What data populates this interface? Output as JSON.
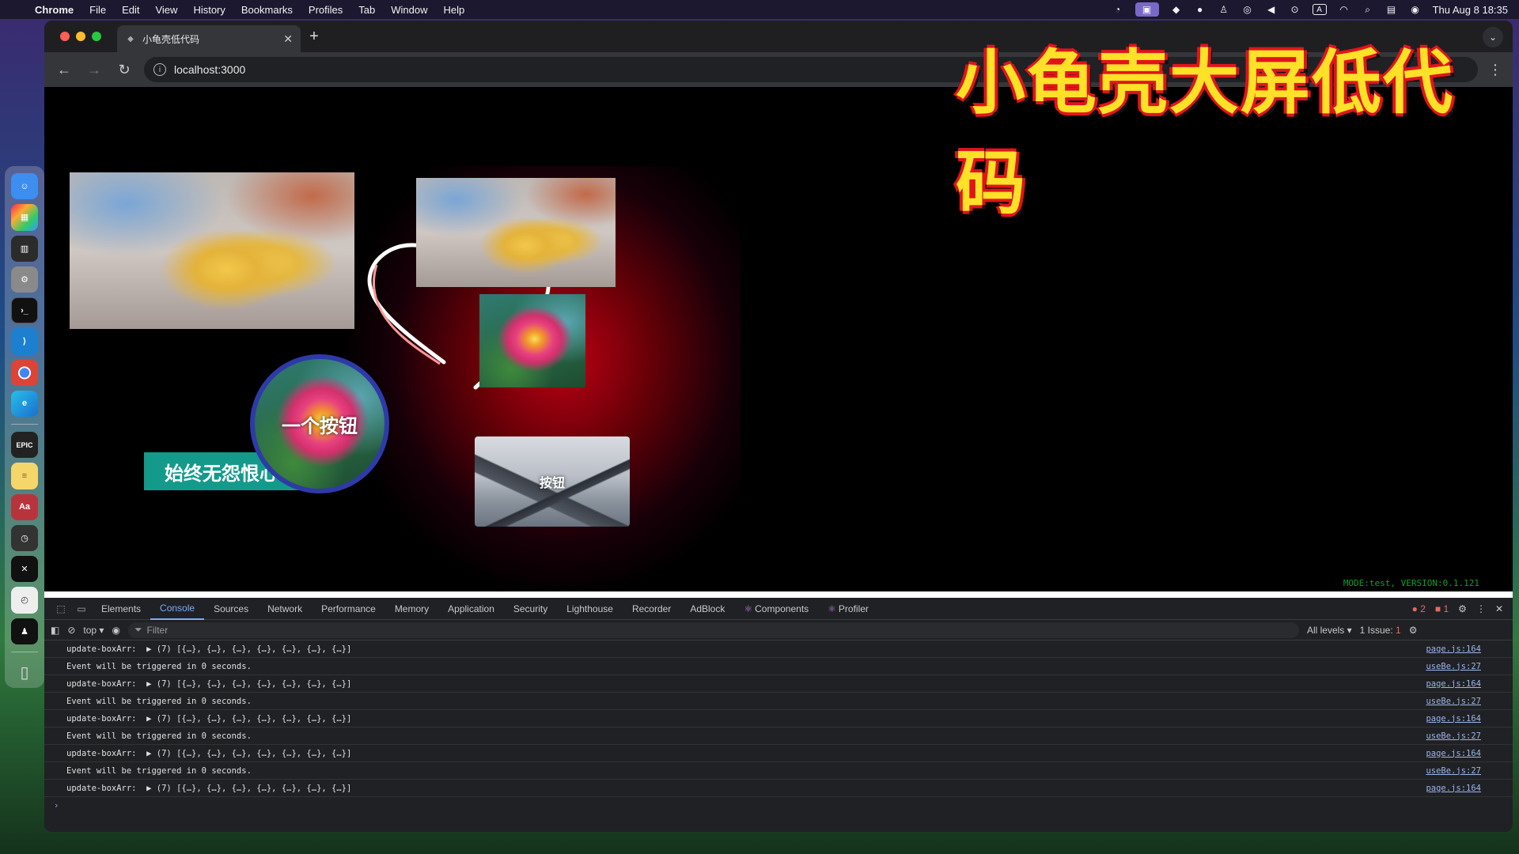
{
  "menubar": {
    "app_name": "Chrome",
    "items": [
      "File",
      "Edit",
      "View",
      "History",
      "Bookmarks",
      "Profiles",
      "Tab",
      "Window",
      "Help"
    ],
    "datetime": "Thu Aug 8  18:35",
    "input_source": "A"
  },
  "dock": {
    "epic_label": "EPIC",
    "dict_label": "Aa"
  },
  "browser": {
    "tab_title": "小龟壳低代码",
    "address": "localhost:3000",
    "close_glyph": "✕",
    "newtab_glyph": "+"
  },
  "watermark": "小龟壳大屏低代码",
  "page": {
    "circle_button_label": "一个按钮",
    "mountain_button_label": "按钮",
    "marquee_text": "始终无怨恨心。",
    "status_text": "MODE:test, VERSION:0.1.121"
  },
  "devtools": {
    "tabs": [
      "Elements",
      "Console",
      "Sources",
      "Network",
      "Performance",
      "Memory",
      "Application",
      "Security",
      "Lighthouse",
      "Recorder",
      "AdBlock",
      "Components",
      "Profiler"
    ],
    "active_tab": "Console",
    "error_count": "2",
    "warning_count": "1",
    "context": "top ▾",
    "filter_placeholder": "Filter",
    "levels": "All levels ▾",
    "issues": "1 Issue:",
    "issues_count": "1",
    "logs": [
      {
        "msg": "update-boxArr:  ▶ (7) [{…}, {…}, {…}, {…}, {…}, {…}, {…}]",
        "src": "page.js:164"
      },
      {
        "msg": "Event will be triggered in 0 seconds.",
        "src": "useBe.js:27"
      },
      {
        "msg": "update-boxArr:  ▶ (7) [{…}, {…}, {…}, {…}, {…}, {…}, {…}]",
        "src": "page.js:164"
      },
      {
        "msg": "Event will be triggered in 0 seconds.",
        "src": "useBe.js:27"
      },
      {
        "msg": "update-boxArr:  ▶ (7) [{…}, {…}, {…}, {…}, {…}, {…}, {…}]",
        "src": "page.js:164"
      },
      {
        "msg": "Event will be triggered in 0 seconds.",
        "src": "useBe.js:27"
      },
      {
        "msg": "update-boxArr:  ▶ (7) [{…}, {…}, {…}, {…}, {…}, {…}, {…}]",
        "src": "page.js:164"
      },
      {
        "msg": "Event will be triggered in 0 seconds.",
        "src": "useBe.js:27"
      },
      {
        "msg": "update-boxArr:  ▶ (7) [{…}, {…}, {…}, {…}, {…}, {…}, {…}]",
        "src": "page.js:164"
      }
    ],
    "prompt": "›"
  },
  "colors": {
    "watermark_fill": "#ffe227",
    "watermark_stroke": "#e1141b",
    "marquee_bg": "#139a8a",
    "circle_border": "#2e3aa8",
    "heart_glow": "#c80014",
    "status_green": "#0aa028"
  }
}
